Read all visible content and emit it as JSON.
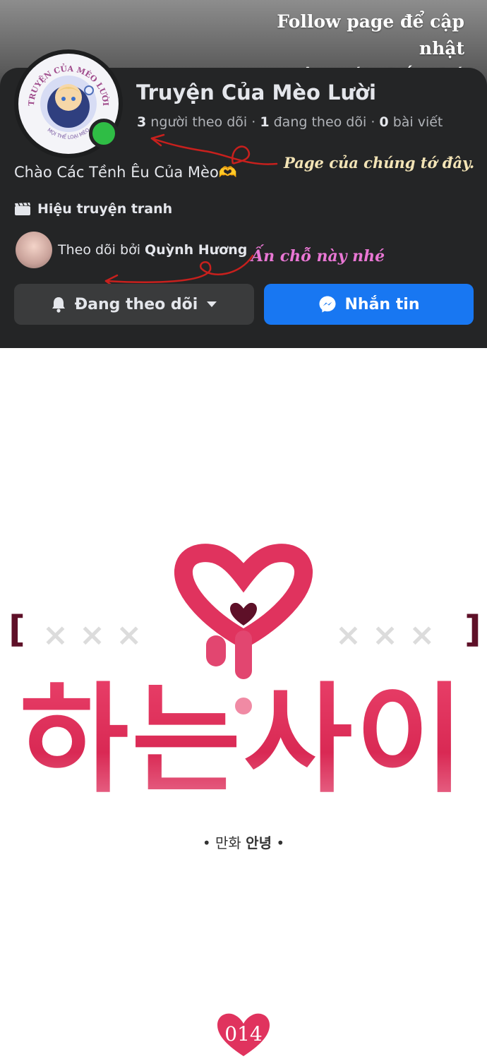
{
  "promo": {
    "line1": "Follow page để cập nhật",
    "line2": "truyện mới nhất nhó"
  },
  "page": {
    "name": "Truyện Của Mèo Lười",
    "followers_count": "3",
    "followers_label": "người theo dõi",
    "following_count": "1",
    "following_label": "đang theo dõi",
    "posts_count": "0",
    "posts_label": "bài viết",
    "bio": "Chào Các Tềnh Êu Của Mèo🫶",
    "category": "Hiệu truyện tranh",
    "followed_by_prefix": "Theo dõi bởi",
    "followed_by_name": "Quỳnh Hương",
    "avatar_text_top": "TRUYỆN CỦA MÈO LƯỜI",
    "avatar_text_bottom": "MỌI THỂ LOẠI MÈO"
  },
  "annotations": {
    "note1": "Page của chúng tớ đây.",
    "note2": "Ấn chỗ này nhé"
  },
  "buttons": {
    "follow": "Đang theo dõi",
    "message": "Nhắn tin"
  },
  "comic": {
    "bracket_left": "[",
    "bracket_right": "]",
    "marks": "× × ×",
    "title": "하는사이",
    "subtitle_prefix": "• 만화",
    "subtitle_name": "안녕",
    "subtitle_suffix": "•",
    "episode": "014"
  },
  "colors": {
    "facebook_blue": "#1877f2",
    "online_green": "#2fbd45",
    "title_pink": "#e0335e",
    "dark_bg": "#242526"
  },
  "icons": {
    "category": "clapperboard-icon",
    "follow": "bell-icon",
    "dropdown": "caret-down-icon",
    "message": "messenger-icon"
  }
}
